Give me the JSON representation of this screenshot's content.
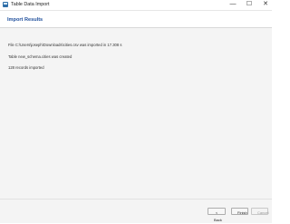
{
  "window": {
    "title": "Table Data Import",
    "minimize_glyph": "—",
    "maximize_glyph": "☐",
    "close_glyph": "✕"
  },
  "header": {
    "title": "Import Results"
  },
  "results": {
    "line1": "File C:\\Users\\joseph\\Downloads\\cities.csv was imported in 17.308 s",
    "line2": "Table new_schema.cities was created",
    "line3": "128 records imported"
  },
  "buttons": {
    "back": "< Back",
    "finish": "Finish",
    "cancel": "Cancel"
  },
  "icons": {
    "app": "app-window-icon"
  }
}
